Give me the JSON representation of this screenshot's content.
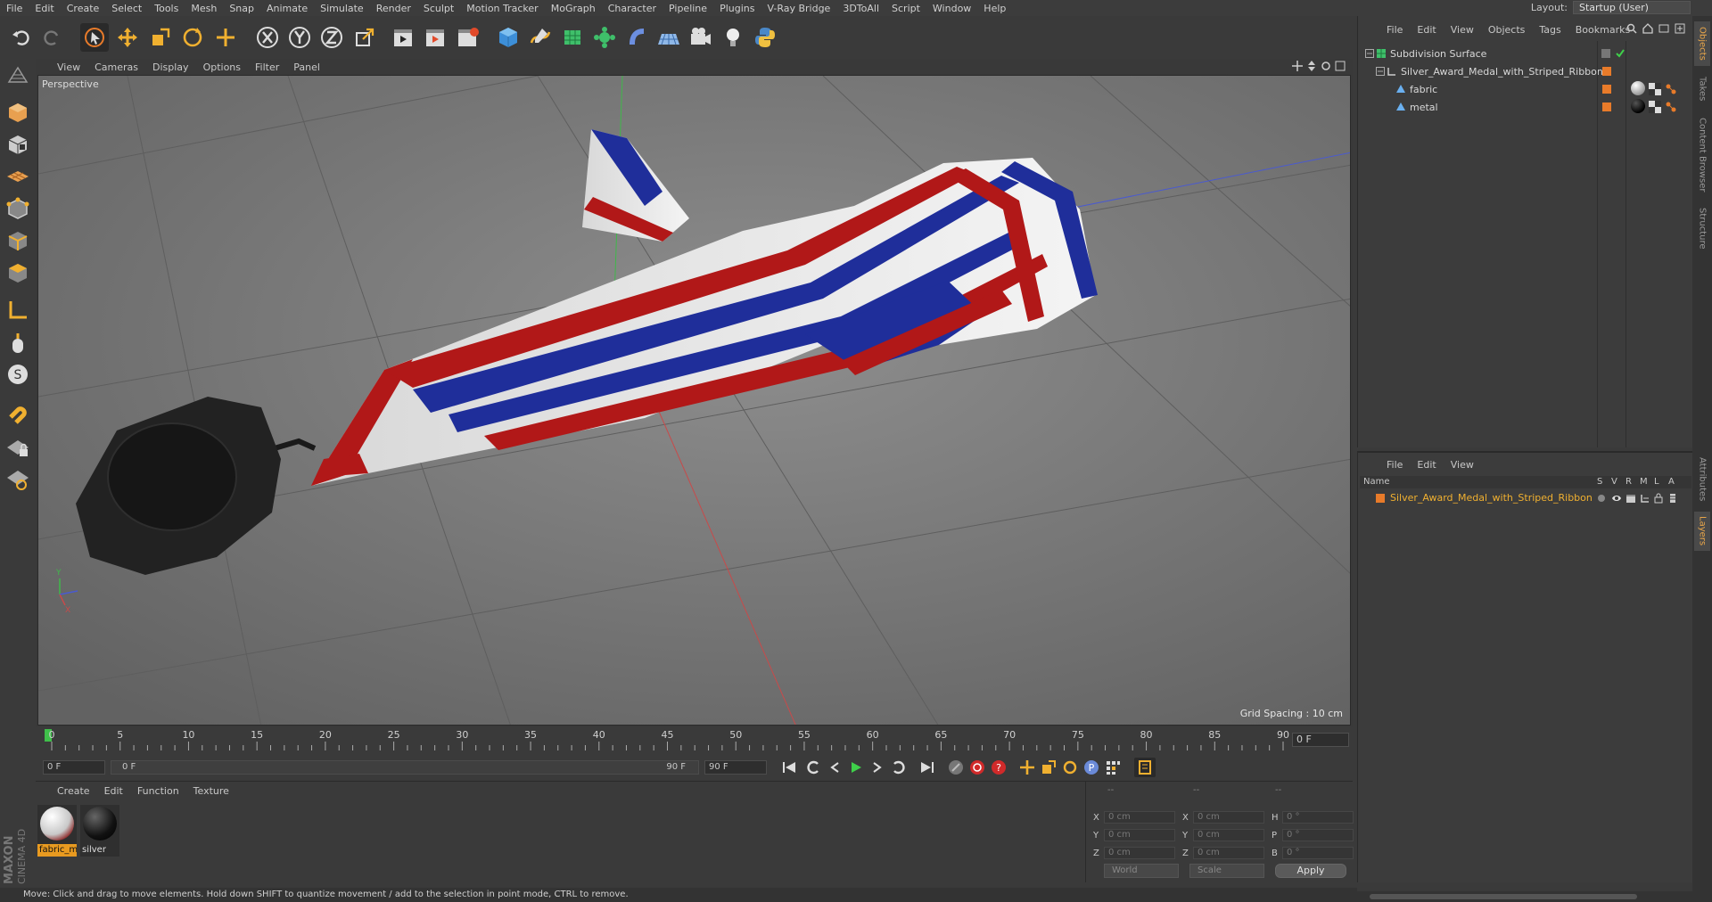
{
  "menu": [
    "File",
    "Edit",
    "Create",
    "Select",
    "Tools",
    "Mesh",
    "Snap",
    "Animate",
    "Simulate",
    "Render",
    "Sculpt",
    "Motion Tracker",
    "MoGraph",
    "Character",
    "Pipeline",
    "Plugins",
    "V-Ray Bridge",
    "3DToAll",
    "Script",
    "Window",
    "Help"
  ],
  "layout": {
    "label": "Layout:",
    "value": "Startup (User)"
  },
  "viewport": {
    "menu": [
      "View",
      "Cameras",
      "Display",
      "Options",
      "Filter",
      "Panel"
    ],
    "label": "Perspective",
    "grid_spacing": "Grid Spacing : 10 cm"
  },
  "timeline": {
    "ticks": [
      "0",
      "5",
      "10",
      "15",
      "20",
      "25",
      "30",
      "35",
      "40",
      "45",
      "50",
      "55",
      "60",
      "65",
      "70",
      "75",
      "80",
      "85",
      "90"
    ],
    "current_frame": "0 F"
  },
  "transport": {
    "start_field": "0 F",
    "range_start": "0 F",
    "range_end": "90 F",
    "end_field": "90 F"
  },
  "materials": {
    "menu": [
      "Create",
      "Edit",
      "Function",
      "Texture"
    ],
    "items": [
      {
        "name": "fabric_m",
        "selected": true
      },
      {
        "name": "silver",
        "selected": false
      }
    ]
  },
  "coords": {
    "headers": [
      "--",
      "--",
      "--"
    ],
    "rows": [
      {
        "l1": "X",
        "v1": "0 cm",
        "l2": "X",
        "v2": "0 cm",
        "l3": "H",
        "v3": "0 °"
      },
      {
        "l1": "Y",
        "v1": "0 cm",
        "l2": "Y",
        "v2": "0 cm",
        "l3": "P",
        "v3": "0 °"
      },
      {
        "l1": "Z",
        "v1": "0 cm",
        "l2": "Z",
        "v2": "0 cm",
        "l3": "B",
        "v3": "0 °"
      }
    ],
    "space": "World",
    "mode": "Scale",
    "apply": "Apply"
  },
  "objects": {
    "menu": [
      "File",
      "Edit",
      "View",
      "Objects",
      "Tags",
      "Bookmarks"
    ],
    "tree": [
      {
        "name": "Subdivision Surface"
      },
      {
        "name": "Silver_Award_Medal_with_Striped_Ribbon"
      },
      {
        "name": "fabric"
      },
      {
        "name": "metal"
      }
    ]
  },
  "layers": {
    "menu": [
      "File",
      "Edit",
      "View"
    ],
    "columns": [
      "Name",
      "S",
      "V",
      "R",
      "M",
      "L",
      "A"
    ],
    "rows": [
      {
        "name": "Silver_Award_Medal_with_Striped_Ribbon",
        "color": "#e87b2a"
      }
    ]
  },
  "side_tabs": [
    "Objects",
    "Takes",
    "Content Browser",
    "Structure",
    "Attributes",
    "Layers"
  ],
  "status": "Move: Click and drag to move elements. Hold down SHIFT to quantize movement / add to the selection in point mode, CTRL to remove.",
  "brand": {
    "line1": "MAXON",
    "line2": "CINEMA 4D"
  },
  "colors": {
    "accent": "#e87b2a",
    "highlight": "#f0b030"
  }
}
